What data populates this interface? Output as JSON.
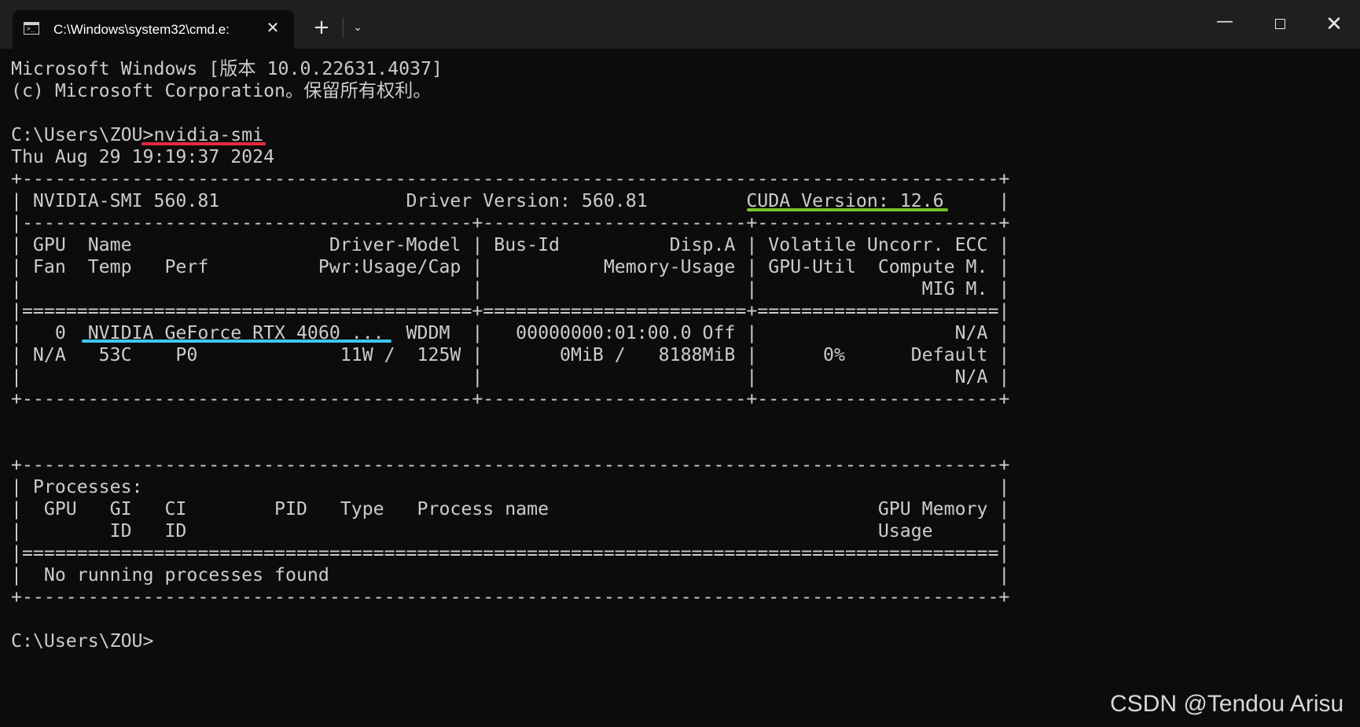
{
  "window": {
    "tab_title": "C:\\Windows\\system32\\cmd.e:",
    "tab_icon": "terminal-icon",
    "tab_icon_glyph": ">_",
    "close_tab_glyph": "✕",
    "new_tab_glyph": "+",
    "dropdown_glyph": "⌄",
    "minimize_glyph": "—",
    "close_glyph": "✕"
  },
  "terminal": {
    "lines": [
      "Microsoft Windows [版本 10.0.22631.4037]",
      "(c) Microsoft Corporation。保留所有权利。",
      "",
      "C:\\Users\\ZOU>nvidia-smi",
      "Thu Aug 29 19:19:37 2024",
      "+-----------------------------------------------------------------------------------------+",
      "| NVIDIA-SMI 560.81                 Driver Version: 560.81         CUDA Version: 12.6     |",
      "|-----------------------------------------+------------------------+----------------------+",
      "| GPU  Name                  Driver-Model | Bus-Id          Disp.A | Volatile Uncorr. ECC |",
      "| Fan  Temp   Perf          Pwr:Usage/Cap |           Memory-Usage | GPU-Util  Compute M. |",
      "|                                         |                        |               MIG M. |",
      "|=========================================+========================+======================|",
      "|   0  NVIDIA GeForce RTX 4060 ...  WDDM  |   00000000:01:00.0 Off |                  N/A |",
      "| N/A   53C    P0             11W /  125W |       0MiB /   8188MiB |      0%      Default |",
      "|                                         |                        |                  N/A |",
      "+-----------------------------------------+------------------------+----------------------+",
      "",
      "",
      "+-----------------------------------------------------------------------------------------+",
      "| Processes:                                                                              |",
      "|  GPU   GI   CI        PID   Type   Process name                              GPU Memory |",
      "|        ID   ID                                                               Usage      |",
      "|=========================================================================================|",
      "|  No running processes found                                                             |",
      "+-----------------------------------------------------------------------------------------+",
      "",
      "C:\\Users\\ZOU>"
    ]
  },
  "annotations": {
    "command_underline_color": "#e8293d",
    "cuda_underline_color": "#76c22a",
    "gpu_name_underline_color": "#3ec6f2"
  },
  "watermark": "CSDN @Tendou Arisu"
}
